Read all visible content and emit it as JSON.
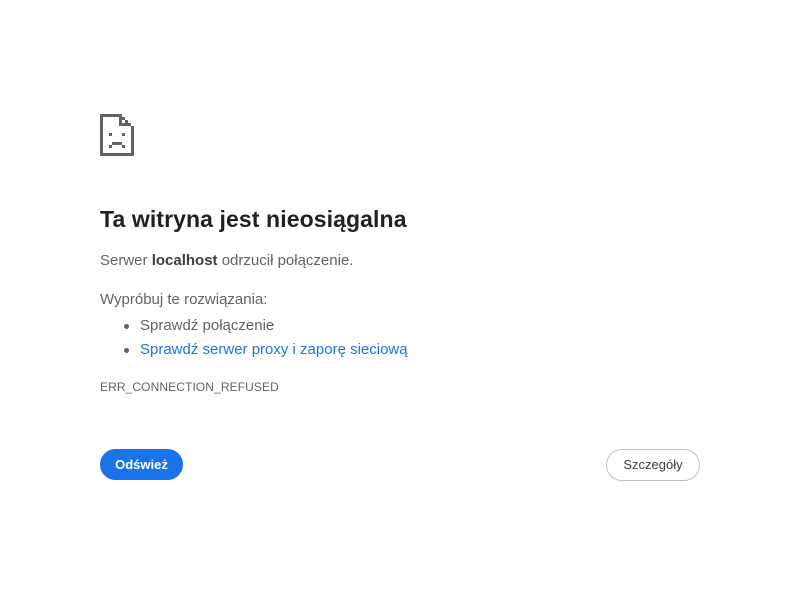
{
  "error_page": {
    "icon": "sad-document-icon",
    "title": "Ta witryna jest nieosiągalna",
    "subtitle": {
      "prefix": "Serwer ",
      "host": "localhost",
      "suffix": " odrzucił połączenie."
    },
    "suggestions_heading": "Wypróbuj te rozwiązania:",
    "suggestions": [
      {
        "label": "Sprawdź połączenie",
        "is_link": false
      },
      {
        "label": "Sprawdź serwer proxy i zaporę sieciową",
        "is_link": true
      }
    ],
    "error_code": "ERR_CONNECTION_REFUSED"
  },
  "buttons": {
    "reload_label": "Odśwież",
    "details_label": "Szczegóły"
  },
  "colors": {
    "accent": "#1a73e8",
    "text_primary": "#202124",
    "text_secondary": "#5f6368"
  }
}
